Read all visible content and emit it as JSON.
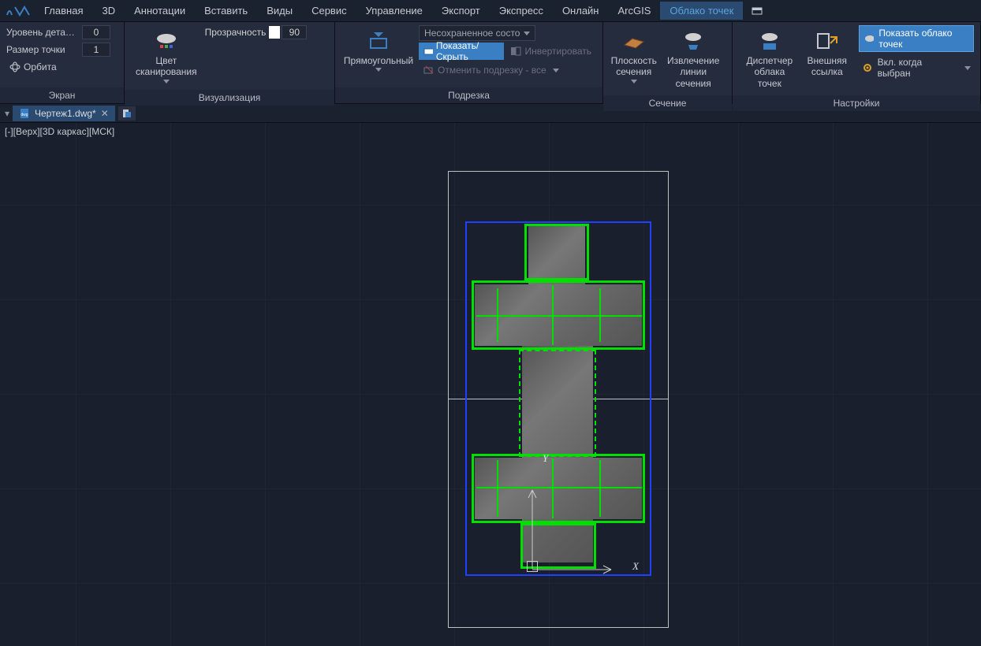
{
  "menu": {
    "items": [
      "Главная",
      "3D",
      "Аннотации",
      "Вставить",
      "Виды",
      "Сервис",
      "Управление",
      "Экспорт",
      "Экспресс",
      "Онлайн",
      "ArcGIS",
      "Облако точек"
    ],
    "active_index": 11
  },
  "ribbon": {
    "screen": {
      "title": "Экран",
      "detail_label": "Уровень детали...",
      "detail_value": "0",
      "point_size_label": "Размер точки",
      "point_size_value": "1",
      "orbit": "Орбита"
    },
    "visual": {
      "title": "Визуализация",
      "scan_color": "Цвет\nсканирования",
      "opacity_label": "Прозрачность",
      "opacity_value": "90"
    },
    "crop": {
      "title": "Подрезка",
      "rect": "Прямоугольный",
      "state_dropdown": "Несохраненное состо",
      "show_hide": "Показать/Скрыть",
      "invert": "Инвертировать",
      "undo_crop": "Отменить подрезку - все"
    },
    "section": {
      "title": "Сечение",
      "plane": "Плоскость\nсечения",
      "extract": "Извлечение\nлинии сечения"
    },
    "settings": {
      "title": "Настройки",
      "manager": "Диспетчер\nоблака точек",
      "external": "Внешняя\nссылка",
      "show_pc": "Показать облако точек",
      "when_selected": "Вкл. когда выбран"
    }
  },
  "doc": {
    "tab_name": "Чертеж1.dwg*"
  },
  "viewport": {
    "label": "[-][Верх][3D каркас][МСК]",
    "axis_x": "X",
    "axis_y": "Y"
  }
}
